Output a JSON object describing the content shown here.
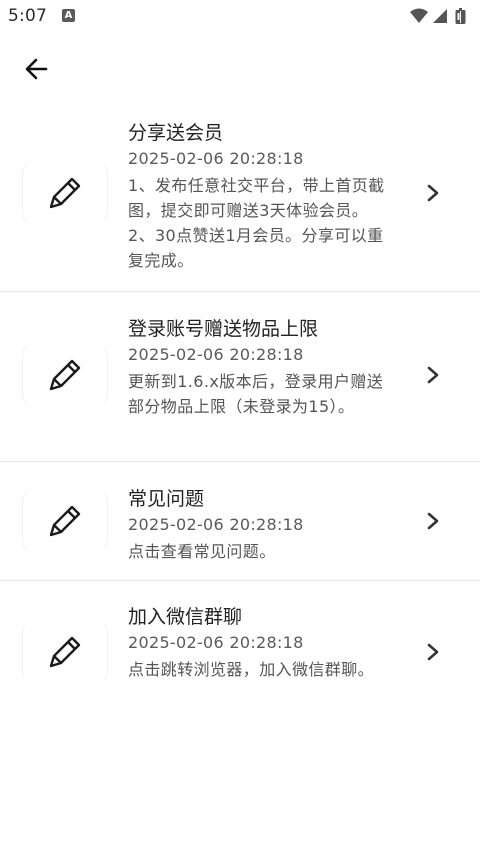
{
  "status_bar": {
    "time": "5:07",
    "notification_icon": "A",
    "icons": [
      "wifi-icon",
      "signal-icon",
      "battery-icon"
    ]
  },
  "header": {
    "back_icon": "arrow-left-icon"
  },
  "items": [
    {
      "icon": "pencil-icon",
      "title": "分享送会员",
      "date": "2025-02-06 20:28:18",
      "description": "1、发布任意社交平台，带上首页截图，提交即可赠送3天体验会员。2、30点赞送1月会员。分享可以重复完成。"
    },
    {
      "icon": "pencil-icon",
      "title": "登录账号赠送物品上限",
      "date": "2025-02-06 20:28:18",
      "description": "更新到1.6.x版本后，登录用户赠送部分物品上限（未登录为15）。"
    },
    {
      "icon": "pencil-icon",
      "title": "常见问题",
      "date": "2025-02-06 20:28:18",
      "description": "点击查看常见问题。"
    },
    {
      "icon": "pencil-icon",
      "title": "加入微信群聊",
      "date": "2025-02-06 20:28:18",
      "description": "点击跳转浏览器，加入微信群聊。"
    }
  ],
  "colors": {
    "background": "#ffffff",
    "divider": "#e6e6e6",
    "text_primary": "#222222",
    "text_secondary": "#555555"
  }
}
